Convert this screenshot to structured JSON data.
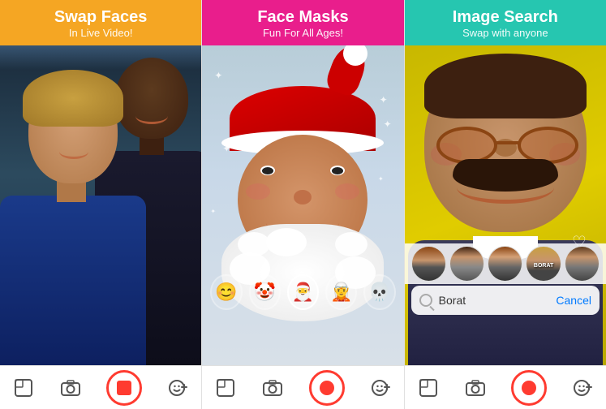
{
  "panels": [
    {
      "id": "swap-faces",
      "header_bg": "#f5a623",
      "title": "Swap Faces",
      "subtitle": "In Live Video!",
      "toolbar": {
        "icons": [
          "gallery",
          "camera",
          "record-stop",
          "emoji-plus"
        ]
      }
    },
    {
      "id": "face-masks",
      "header_bg": "#e91e8c",
      "title": "Face Masks",
      "subtitle": "Fun For All Ages!",
      "stickers": [
        "😊",
        "🤡",
        "🎅",
        "🧝",
        "💀"
      ],
      "toolbar": {
        "icons": [
          "gallery",
          "camera",
          "record-dot",
          "emoji-plus"
        ]
      }
    },
    {
      "id": "image-search",
      "header_bg": "#26c6b0",
      "title": "Image Search",
      "subtitle": "Swap with anyone",
      "search": {
        "placeholder": "Borat",
        "cancel_label": "Cancel"
      },
      "toolbar": {
        "icons": [
          "gallery",
          "camera",
          "record-dot",
          "emoji-plus"
        ]
      }
    }
  ]
}
